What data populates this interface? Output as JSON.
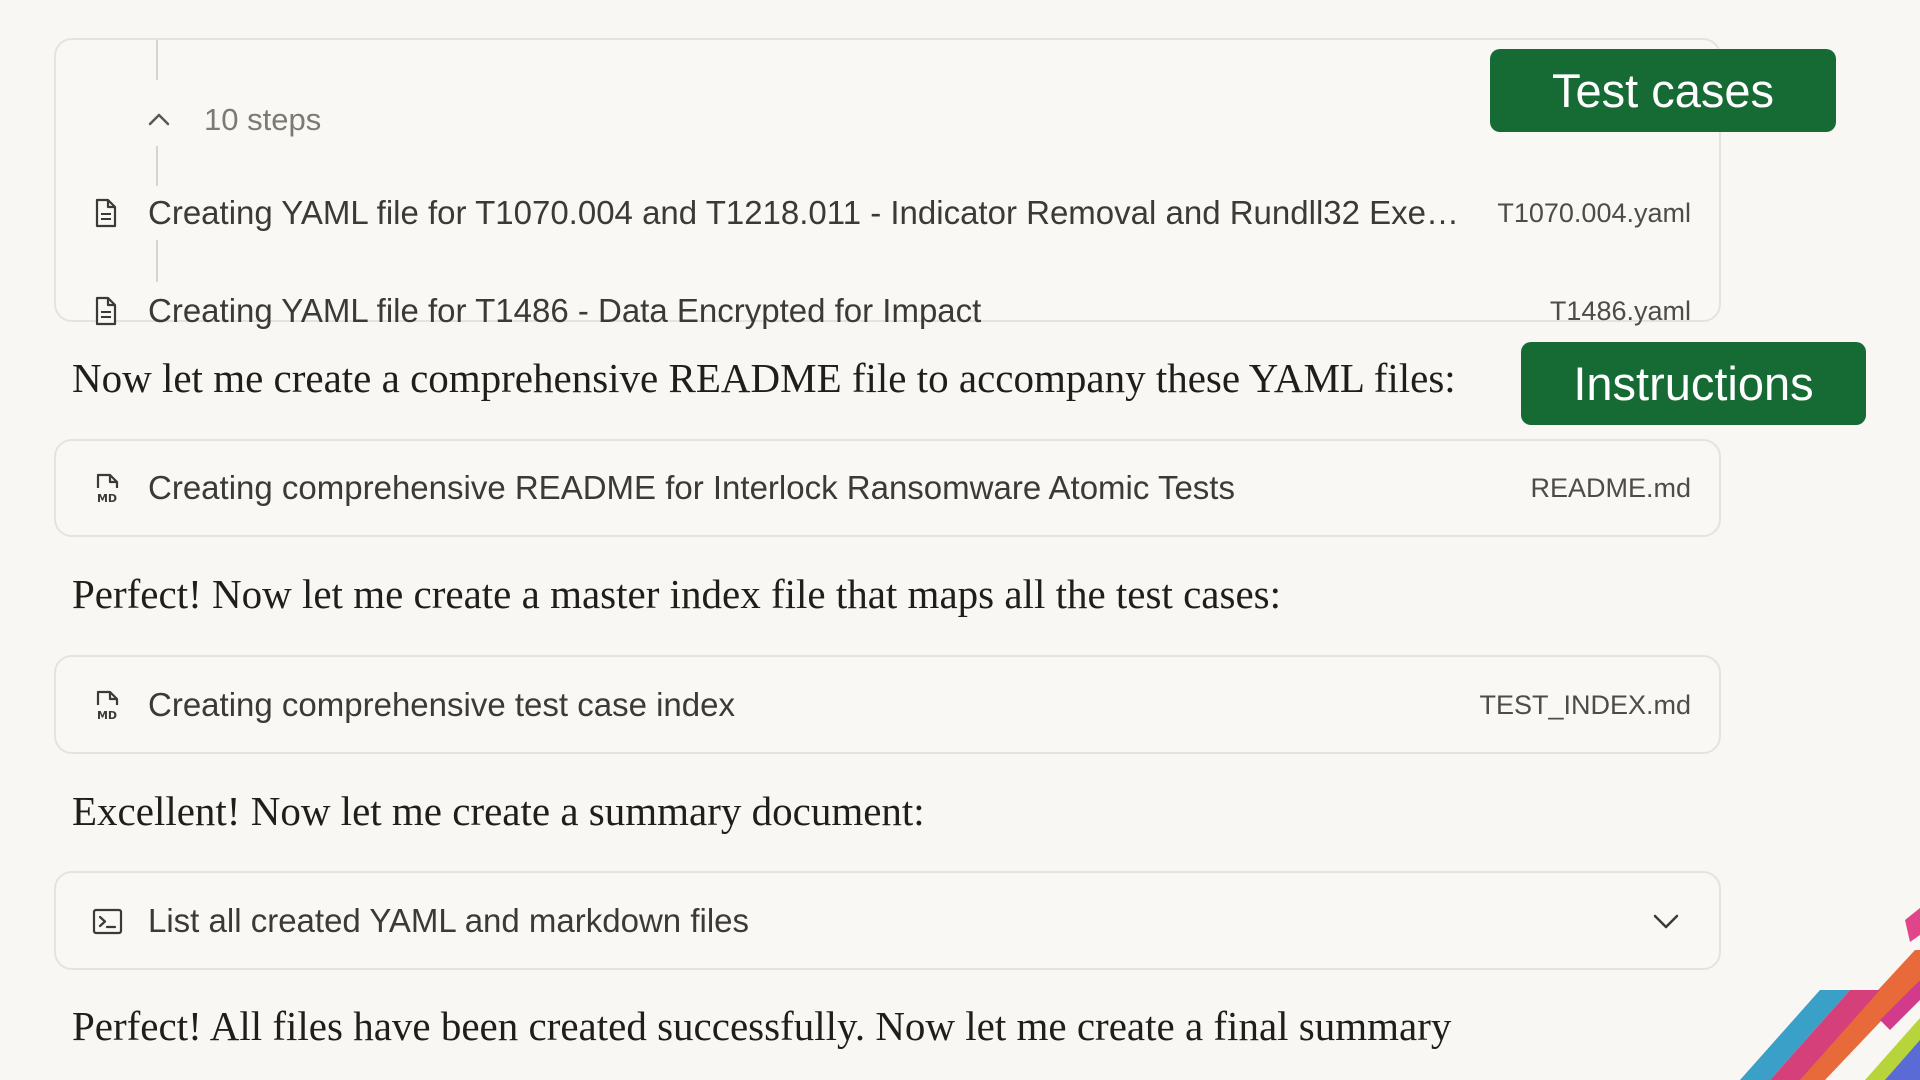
{
  "steps_group": {
    "count_label": "10 steps",
    "items": [
      {
        "label": "Creating YAML file for T1070.004 and T1218.011 - Indicator Removal and Rundll32 Exe…",
        "file": "T1070.004.yaml",
        "icon": "document-icon"
      },
      {
        "label": "Creating YAML file for T1486 - Data Encrypted for Impact",
        "file": "T1486.yaml",
        "icon": "document-icon"
      }
    ]
  },
  "messages": [
    "Now let me create a comprehensive README file to accompany these YAML files:",
    "Perfect! Now let me create a master index file that maps all the test cases:",
    "Excellent! Now let me create a summary document:",
    "Perfect! All files have been created successfully. Now let me create a final summary"
  ],
  "tool_cards": [
    {
      "label": "Creating comprehensive README for Interlock Ransomware Atomic Tests",
      "file": "README.md",
      "icon": "markdown-file-icon"
    },
    {
      "label": "Creating comprehensive test case index",
      "file": "TEST_INDEX.md",
      "icon": "markdown-file-icon"
    },
    {
      "label": "List all created YAML and markdown files",
      "icon": "terminal-icon"
    }
  ],
  "annotations": {
    "test_cases": "Test cases",
    "instructions": "Instructions"
  },
  "colors": {
    "background": "#f8f7f3",
    "badge_green": "#166b35",
    "card_border": "#e6e3dc"
  }
}
